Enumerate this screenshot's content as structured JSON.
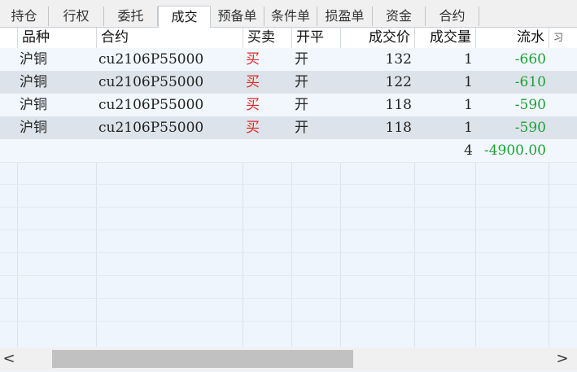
{
  "tabs": [
    "持仓",
    "行权",
    "委托",
    "成交",
    "预备单",
    "条件单",
    "损盈单",
    "资金",
    "合约"
  ],
  "active_tab": "成交",
  "columns": [
    "品种",
    "合约",
    "买卖",
    "开平",
    "成交价",
    "成交量",
    "流水",
    "习"
  ],
  "rows": [
    {
      "variety": "沪铜",
      "contract": "cu2106P55000",
      "side": "买",
      "openclose": "开",
      "price": "132",
      "qty": "1",
      "flow": "-660"
    },
    {
      "variety": "沪铜",
      "contract": "cu2106P55000",
      "side": "买",
      "openclose": "开",
      "price": "122",
      "qty": "1",
      "flow": "-610"
    },
    {
      "variety": "沪铜",
      "contract": "cu2106P55000",
      "side": "买",
      "openclose": "开",
      "price": "118",
      "qty": "1",
      "flow": "-590"
    },
    {
      "variety": "沪铜",
      "contract": "cu2106P55000",
      "side": "买",
      "openclose": "开",
      "price": "118",
      "qty": "1",
      "flow": "-590"
    }
  ],
  "totals": {
    "qty": "4",
    "flow": "-4900.00"
  },
  "scroll": {
    "left_arrow": "<",
    "right_arrow": ">"
  },
  "colors": {
    "buy": "#e0282b",
    "negative_flow": "#1aa231",
    "row_alt": "#dde3ea"
  }
}
